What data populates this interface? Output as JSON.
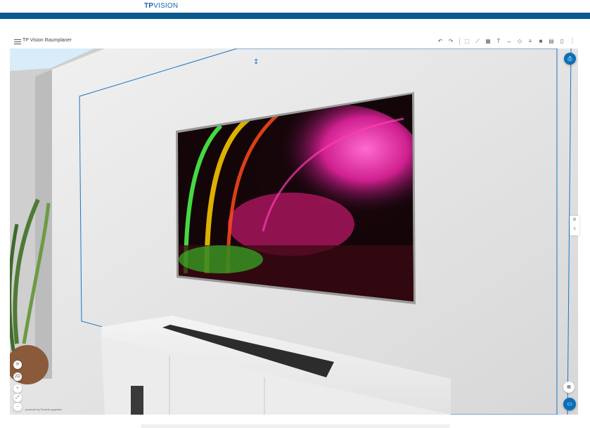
{
  "brand": {
    "logo_tp": "TP",
    "logo_vision": "VISION",
    "color": "#0a5a8e"
  },
  "toolbar": {
    "title": "TP Vision Raumplaner",
    "icons": [
      "undo-icon",
      "redo-icon",
      "add-room-icon",
      "draw-wall-icon",
      "floor-pattern-icon",
      "text-icon",
      "measure-icon",
      "shape-icon",
      "camera-icon",
      "align-icon",
      "layers-icon",
      "document-icon",
      "more-icon"
    ]
  },
  "viewport": {
    "zoom_controls": {
      "mode_label": "2D"
    },
    "powered_by": "powered by Roomle graphics",
    "accent": "#1c74c4"
  }
}
